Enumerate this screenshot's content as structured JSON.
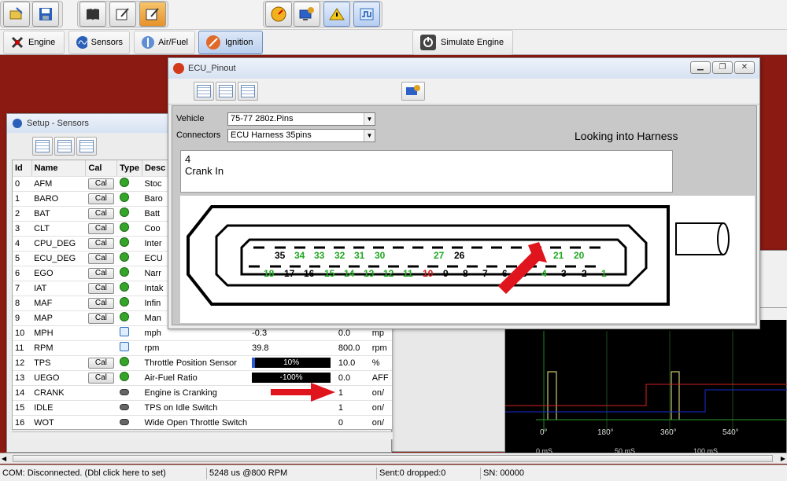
{
  "toolbar": {
    "buttons": [
      "open-icon",
      "save-icon",
      "book-icon",
      "edit-icon",
      "edit-active-icon",
      "gauge-icon",
      "computer-gear-icon",
      "warning-icon",
      "wave-icon"
    ]
  },
  "tabs": [
    {
      "label": "Engine"
    },
    {
      "label": "Sensors"
    },
    {
      "label": "Air/Fuel"
    },
    {
      "label": "Ignition"
    }
  ],
  "simulate": {
    "label": "Simulate Engine"
  },
  "sensors": {
    "title": "Setup - Sensors",
    "headers": [
      "Id",
      "Name",
      "Cal",
      "Type",
      "Desc"
    ],
    "rows": [
      {
        "id": "0",
        "name": "AFM",
        "cal": "Cal",
        "type": "dot",
        "desc": "Stoc",
        "val1": "",
        "val2": "",
        "unit": ""
      },
      {
        "id": "1",
        "name": "BARO",
        "cal": "Cal",
        "type": "dot",
        "desc": "Baro",
        "val1": "",
        "val2": "",
        "unit": ""
      },
      {
        "id": "2",
        "name": "BAT",
        "cal": "Cal",
        "type": "dot",
        "desc": "Batt",
        "val1": "",
        "val2": "",
        "unit": ""
      },
      {
        "id": "3",
        "name": "CLT",
        "cal": "Cal",
        "type": "dot",
        "desc": "Coo",
        "val1": "",
        "val2": "",
        "unit": ""
      },
      {
        "id": "4",
        "name": "CPU_DEG",
        "cal": "Cal",
        "type": "dot",
        "desc": "Inter",
        "val1": "",
        "val2": "",
        "unit": ""
      },
      {
        "id": "5",
        "name": "ECU_DEG",
        "cal": "Cal",
        "type": "dot",
        "desc": "ECU",
        "val1": "",
        "val2": "",
        "unit": ""
      },
      {
        "id": "6",
        "name": "EGO",
        "cal": "Cal",
        "type": "dot",
        "desc": "Narr",
        "val1": "",
        "val2": "",
        "unit": ""
      },
      {
        "id": "7",
        "name": "IAT",
        "cal": "Cal",
        "type": "dot",
        "desc": "Intak",
        "val1": "",
        "val2": "",
        "unit": ""
      },
      {
        "id": "8",
        "name": "MAF",
        "cal": "Cal",
        "type": "dot",
        "desc": "Infin",
        "val1": "",
        "val2": "",
        "unit": ""
      },
      {
        "id": "9",
        "name": "MAP",
        "cal": "Cal",
        "type": "dot",
        "desc": "Man",
        "val1": "",
        "val2": "",
        "unit": ""
      },
      {
        "id": "10",
        "name": "MPH",
        "cal": "",
        "type": "sq",
        "desc": "mph",
        "val1": "-0.3",
        "val2": "0.0",
        "unit": "mp"
      },
      {
        "id": "11",
        "name": "RPM",
        "cal": "",
        "type": "sq",
        "desc": "rpm",
        "val1": "39.8",
        "val2": "800.0",
        "unit": "rpm"
      },
      {
        "id": "12",
        "name": "TPS",
        "cal": "Cal",
        "type": "dot",
        "desc": "Throttle Position Sensor",
        "bar": "10%",
        "barfill": 0.04,
        "val2": "10.0",
        "unit": "%"
      },
      {
        "id": "13",
        "name": "UEGO",
        "cal": "Cal",
        "type": "dot",
        "desc": "Air-Fuel Ratio",
        "bar": "-100%",
        "barfill": 0,
        "val2": "0.0",
        "unit": "AFF"
      },
      {
        "id": "14",
        "name": "CRANK",
        "cal": "",
        "type": "sw",
        "desc": "Engine is Cranking",
        "val1": "",
        "val2": "1",
        "unit": "on/"
      },
      {
        "id": "15",
        "name": "IDLE",
        "cal": "",
        "type": "sw",
        "desc": "TPS on Idle Switch",
        "val1": "",
        "val2": "1",
        "unit": "on/"
      },
      {
        "id": "16",
        "name": "WOT",
        "cal": "",
        "type": "sw",
        "desc": "Wide Open Throttle Switch",
        "val1": "",
        "val2": "0",
        "unit": "on/"
      }
    ]
  },
  "pinout": {
    "title": "ECU_Pinout",
    "vehicle_label": "Vehicle",
    "vehicle_value": "75-77 280z.Pins",
    "connectors_label": "Connectors",
    "connectors_value": "ECU Harness 35pins",
    "view_label": "Looking into Harness",
    "info_line1": "4",
    "info_line2": "Crank In",
    "top_pins": [
      {
        "n": "35",
        "c": "#000"
      },
      {
        "n": "34",
        "c": "#1fa81f"
      },
      {
        "n": "33",
        "c": "#1fa81f"
      },
      {
        "n": "32",
        "c": "#1fa81f"
      },
      {
        "n": "31",
        "c": "#1fa81f"
      },
      {
        "n": "30",
        "c": "#1fa81f"
      },
      {
        "n": "27",
        "c": "#1fa81f"
      },
      {
        "n": "26",
        "c": "#000"
      },
      {
        "n": "21",
        "c": "#1fa81f"
      },
      {
        "n": "20",
        "c": "#1fa81f"
      }
    ],
    "bottom_pins": [
      {
        "n": "18",
        "c": "#1fa81f"
      },
      {
        "n": "17",
        "c": "#000"
      },
      {
        "n": "16",
        "c": "#000"
      },
      {
        "n": "15",
        "c": "#1fa81f"
      },
      {
        "n": "14",
        "c": "#1fa81f"
      },
      {
        "n": "13",
        "c": "#1fa81f"
      },
      {
        "n": "12",
        "c": "#1fa81f"
      },
      {
        "n": "11",
        "c": "#1fa81f"
      },
      {
        "n": "10",
        "c": "#d01515"
      },
      {
        "n": "9",
        "c": "#000"
      },
      {
        "n": "8",
        "c": "#000"
      },
      {
        "n": "7",
        "c": "#000"
      },
      {
        "n": "6",
        "c": "#000"
      },
      {
        "n": "5",
        "c": "#000"
      },
      {
        "n": "4",
        "c": "#1fa81f"
      },
      {
        "n": "3",
        "c": "#000"
      },
      {
        "n": "2",
        "c": "#000"
      },
      {
        "n": "1",
        "c": "#1fa81f"
      }
    ]
  },
  "scope": {
    "deg_labels": [
      "0°",
      "180°",
      "360°",
      "540°"
    ],
    "ms_labels": [
      "0 mS",
      "50 mS",
      "100 mS"
    ]
  },
  "status": {
    "com": "COM: Disconnected. (Dbl click here to set)",
    "timing": "5248 us @800  RPM",
    "sent": "Sent:0 dropped:0",
    "sn": "SN: 00000"
  }
}
